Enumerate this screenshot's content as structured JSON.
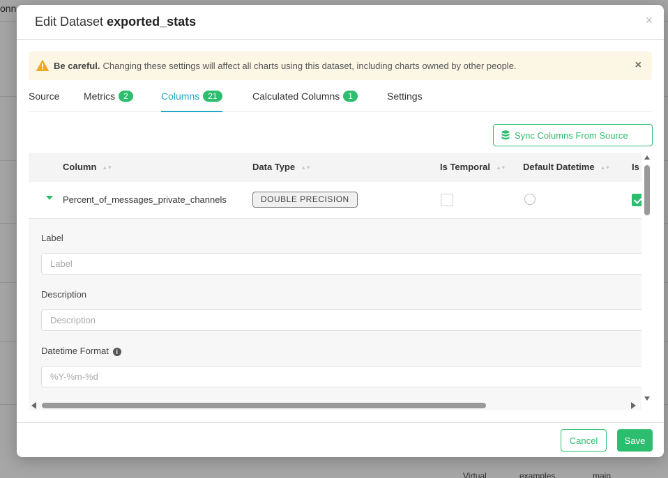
{
  "background": {
    "corner_text": "onn",
    "bottom_texts": [
      "Virtual",
      "examples",
      "main"
    ]
  },
  "modal": {
    "title_prefix": "Edit Dataset",
    "title_dataset": "exported_stats",
    "close_glyph": "×"
  },
  "alert": {
    "strong": "Be careful.",
    "message": "Changing these settings will affect all charts using this dataset, including charts owned by other people.",
    "close_glyph": "×",
    "icon": "warning-icon",
    "color": "#fcf6e5"
  },
  "tabs": [
    {
      "label": "Source",
      "count": null
    },
    {
      "label": "Metrics",
      "count": "2"
    },
    {
      "label": "Columns",
      "count": "21",
      "active": true
    },
    {
      "label": "Calculated Columns",
      "count": "1"
    },
    {
      "label": "Settings",
      "count": null
    }
  ],
  "sync_button": {
    "label": "Sync Columns From Source",
    "icon": "database-icon"
  },
  "table": {
    "headers": [
      "Column",
      "Data Type",
      "Is Temporal",
      "Default Datetime",
      "Is"
    ],
    "rows": [
      {
        "column": "Percent_of_messages_private_channels",
        "data_type": "DOUBLE PRECISION",
        "is_temporal": false,
        "default_datetime": false,
        "is_filterable": true
      }
    ],
    "expanded": {
      "label_field": {
        "label": "Label",
        "placeholder": "Label"
      },
      "description_field": {
        "label": "Description",
        "placeholder": "Description"
      },
      "datetime_field": {
        "label": "Datetime Format",
        "placeholder": "%Y-%m-%d"
      }
    }
  },
  "footer": {
    "cancel": "Cancel",
    "save": "Save"
  },
  "colors": {
    "accent": "#2dbd6e",
    "tab_active": "#20a7c9"
  }
}
